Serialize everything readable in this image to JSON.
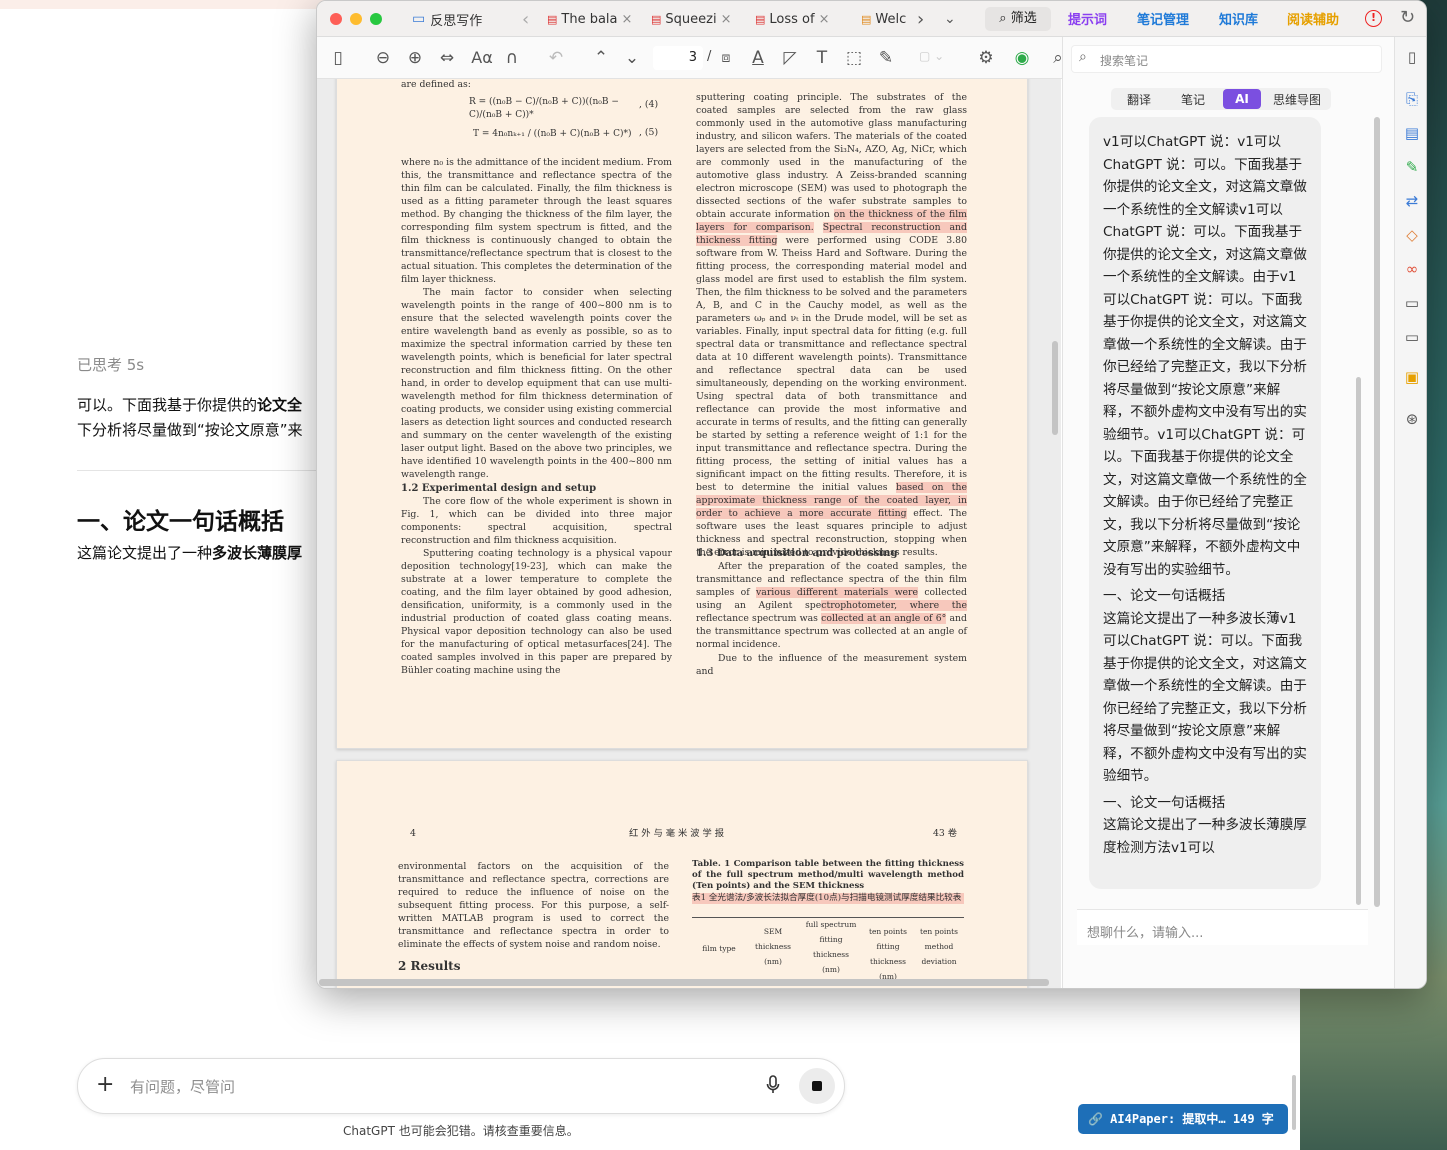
{
  "chat_bg": {
    "thinking": "已思考 5s",
    "para_start": "可以。下面我基于你提供的",
    "para_bold": "论文全",
    "para_line2": "下分析将尽量做到“按论文原意”来",
    "heading": "一、论文一句话概括",
    "summary_start": "这篇论文提出了一种",
    "summary_bold": "多波长薄膜厚",
    "input_placeholder": "有问题，尽管问",
    "disclaimer": "ChatGPT 也可能会犯错。请核查重要信息。"
  },
  "window": {
    "tabs": [
      "反思写作",
      "The bala",
      "Squeezi",
      "Loss of",
      "Welc"
    ],
    "tools": [
      "筛选",
      "提示词",
      "笔记管理",
      "知识库",
      "阅读辅助"
    ],
    "page_num": "3",
    "search_placeholder": "搜索笔记",
    "panel_tabs": [
      "翻译",
      "笔记",
      "AI",
      "思维导图"
    ],
    "ai_message": "v1可以ChatGPT 说：v1可以ChatGPT 说：可以。下面我基于你提供的论文全文，对这篇文章做一个系统性的全文解读v1可以ChatGPT 说：可以。下面我基于你提供的论文全文，对这篇文章做一个系统性的全文解读。由于v1可以ChatGPT 说：可以。下面我基于你提供的论文全文，对这篇文章做一个系统性的全文解读。由于你已经给了完整正文，我以下分析将尽量做到“按论文原意”来解释，不额外虚构文中没有写出的实验细节。v1可以ChatGPT 说：可以。下面我基于你提供的论文全文，对这篇文章做一个系统性的全文解读。由于你已经给了完整正文，我以下分析将尽量做到“按论文原意”来解释，不额外虚构文中没有写出的实验细节。",
    "ai_message2_head": "一、论文一句话概括",
    "ai_message2": "这篇论文提出了一种多波长薄v1可以ChatGPT 说：可以。下面我基于你提供的论文全文，对这篇文章做一个系统性的全文解读。由于你已经给了完整正文，我以下分析将尽量做到“按论文原意”来解释，不额外虚构文中没有写出的实验细节。",
    "ai_message3_head": "一、论文一句话概括",
    "ai_message3": "这篇论文提出了一种多波长薄膜厚度检测方法v1可以",
    "chat_input_placeholder": "想聊什么，请输入...",
    "badge": "AI4Paper: 提取中… 149 字"
  },
  "pdf": {
    "page3_left": [
      "are defined as:",
      "where n₀ is the admittance of the incident medium. From this, the transmittance and reflectance spectra of the thin film can be calculated. Finally, the film thickness is used as a fitting parameter through the least squares method. By changing the thickness of the film layer, the corresponding film system spectrum is fitted, and the film thickness is continuously changed to obtain the transmittance/reflectance spectrum that is closest to the actual situation. This completes the determination of the film layer thickness.",
      "The main factor to consider when selecting wavelength points in the range of 400~800 nm is to ensure that the selected wavelength points cover the entire wavelength band as evenly as possible, so as to maximize the spectral information carried by these ten wavelength points, which is beneficial for later spectral reconstruction and film thickness fitting. On the other hand, in order to develop equipment that can use multi-wavelength method for film thickness determination of coating products, we consider using existing commercial lasers as detection light sources and conducted research and summary on the center wavelength of the existing laser output light. Based on the above two principles, we have identified 10 wavelength points in the 400~800 nm wavelength range.",
      "1.2  Experimental design and setup",
      "The core flow of the whole experiment is shown in Fig. 1, which can be divided into three major components: spectral acquisition, spectral reconstruction and film thickness acquisition.",
      "Sputtering coating technology is a physical vapour deposition technology[19-23], which can make the substrate at a lower temperature to complete the coating, and the film layer obtained by good adhesion, densification, uniformity, is a commonly used in the industrial production of coated glass coating means. Physical vapor deposition technology can also be used for the manufacturing of optical metasurfaces[24]. The coated samples involved in this paper are prepared by Bühler coating machine using the"
    ],
    "eq4": "R = ((n₀B − C)/(n₀B + C))((n₀B − C)/(n₀B + C))*",
    "eq4_num": ",  (4)",
    "eq5": "T = 4n₀nₖ₊₁ / ((n₀B + C)(n₀B + C)*)",
    "eq5_num": ",  (5)",
    "page3_right_pre": "sputtering coating principle. The substrates of the coated samples are selected from the raw glass commonly used in the automotive glass manufacturing industry, and silicon wafers. The materials of the coated layers are selected from the Si₃N₄, AZO, Ag, NiCr, which are commonly used in the manufacturing of the automotive glass industry. A Zeiss-branded scanning electron microscope (SEM) was used to photograph the dissected sections of the wafer substrate samples to obtain accurate information",
    "page3_right_hl1": "on the thickness of the film layers for comparison.",
    "page3_right_hl2": "Spectral reconstruction and thickness fitting",
    "page3_right_mid": "were performed using CODE 3.80 software from W. Theiss Hard and Software. During the fitting process, the corresponding material model and glass model are first used to establish the film system. Then, the film thickness to be solved and the parameters A, B, and C in the Cauchy model, as well as the parameters ωₚ and νₜ in the Drude model, will be set as variables. Finally, input spectral data for fitting (e.g. full spectral data or transmittance and reflectance spectral data at 10 different wavelength points). Transmittance and reflectance spectral data can be used simultaneously, depending on the working environment. Using spectral data of both transmittance and reflectance can provide the most informative and accurate in terms of results, and the fitting can generally be started by setting a reference weight of 1:1 for the input transmittance and reflectance spectra. During the fitting process, the setting of initial values has a significant impact on the fitting results. Therefore, it is best to determine the initial values",
    "page3_right_hl3": "based on the approximate thickness range of the coated layer, in order to achieve a more accurate fitting",
    "page3_right_end": "effect. The software uses the least squares principle to adjust thickness and spectral reconstruction, stopping when the error is minimized to provide thickness results.",
    "sec13": "1.3  Data acquisition and processing",
    "page3_right_post1": "After the preparation of the coated samples, the transmittance and reflectance spectra of the thin film samples of",
    "page3_right_hl4": "various different materials were",
    "page3_right_post2": "collected using an Agilent spe",
    "page3_right_hl5": "ctrophotometer, where the",
    "page3_right_post3": "reflectance spectrum was",
    "page3_right_hl6": "collected at an angle of 6°",
    "page3_right_post4": "and the transmittance spectrum was collected at an angle of normal incidence.",
    "page3_right_last": "Due to the influence of the measurement system and",
    "p4_pagenum": "4",
    "p4_journal": "红 外 与 毫 米 波 学 报",
    "p4_vol": "43 卷",
    "p4_left": "environmental factors on the acquisition of the transmittance and reflectance spectra, corrections are required to reduce the influence of noise on the subsequent fitting process. For this purpose, a self-written MATLAB program is used to correct the transmittance and reflectance spectra in order to eliminate the effects of system noise and random noise.",
    "p4_results": "2  Results",
    "p4_table_caption": "Table. 1  Comparison table between the fitting thickness of the full spectrum method/multi wavelength method (Ten points) and the SEM thickness",
    "p4_table_caption_cn": "表1  全光谱法/多波长法拟合厚度(10点)与扫描电镜测试厚度结果比较表",
    "p4_table_headers": [
      "film type",
      "SEM thickness (nm)",
      "full spectrum fitting thickness (nm)",
      "ten points fitting thickness (nm)",
      "ten points method deviation"
    ]
  }
}
